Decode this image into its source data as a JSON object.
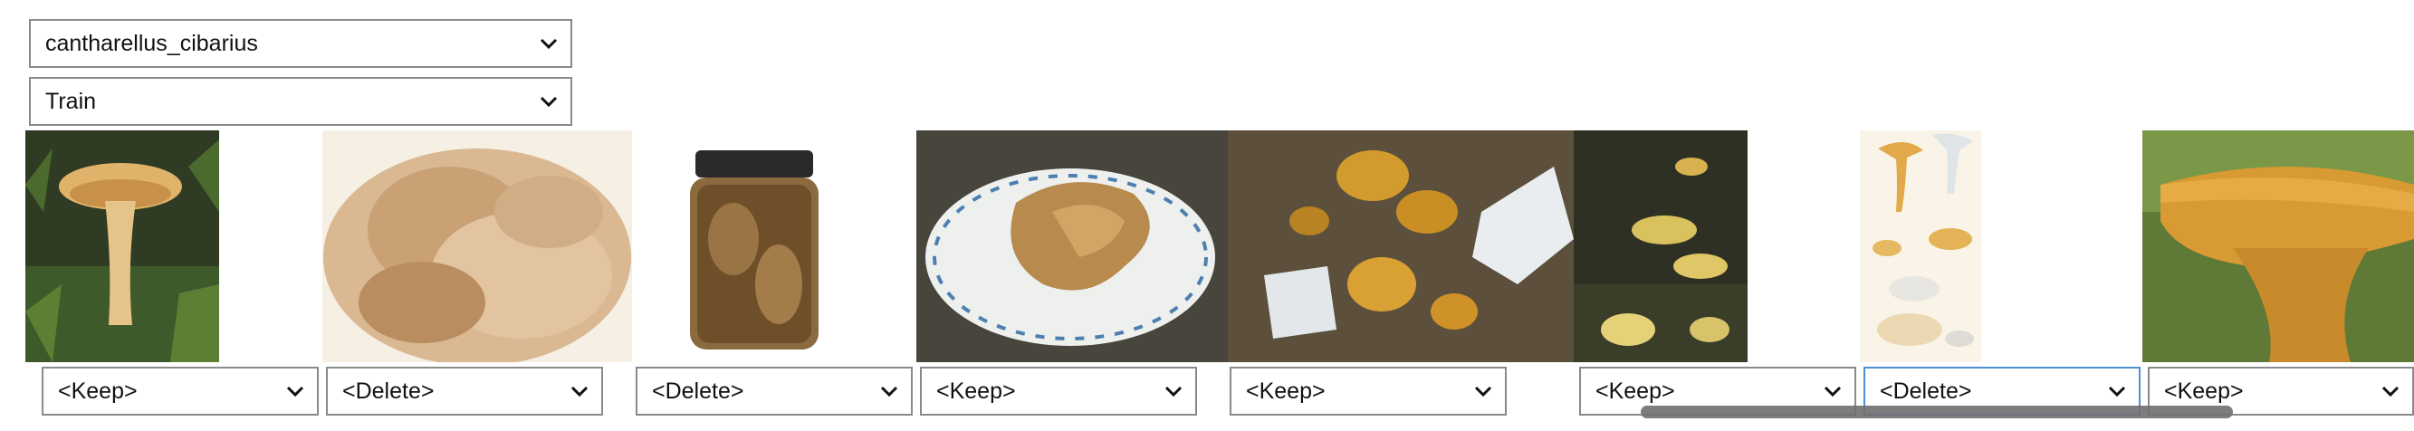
{
  "species_select": {
    "value": "cantharellus_cibarius"
  },
  "split_select": {
    "value": "Train"
  },
  "images": [
    {
      "icon": "chanterelle-on-moss-photo"
    },
    {
      "icon": "dried-mushroom-pile-photo"
    },
    {
      "icon": "mushroom-jar-photo"
    },
    {
      "icon": "mushroom-plate-photo"
    },
    {
      "icon": "chanterelles-in-leaves-photo"
    },
    {
      "icon": "mushroom-cluster-photo"
    },
    {
      "icon": "mushroom-illustration"
    },
    {
      "icon": "chanterelle-closeup-photo"
    }
  ],
  "actions": [
    {
      "value": "<Keep>"
    },
    {
      "value": "<Delete>"
    },
    {
      "value": "<Delete>"
    },
    {
      "value": "<Keep>"
    },
    {
      "value": "<Keep>"
    },
    {
      "value": "<Keep>"
    },
    {
      "value": "<Delete>"
    },
    {
      "value": "<Keep>"
    }
  ]
}
